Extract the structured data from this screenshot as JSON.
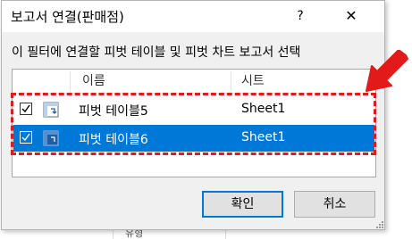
{
  "dialog": {
    "title": "보고서 연결(판매점)",
    "help_label": "?",
    "close_label": "✕",
    "instruction": "이 필터에 연결할 피벗 테이블 및 피벗 차트 보고서 선택"
  },
  "list": {
    "columns": [
      "이름",
      "시트"
    ],
    "rows": [
      {
        "checked": true,
        "name": "피벗 테이블5",
        "sheet": "Sheet1",
        "selected": false,
        "icon": "pivot-table-icon"
      },
      {
        "checked": true,
        "name": "피벗 테이블6",
        "sheet": "Sheet1",
        "selected": true,
        "icon": "pivot-table-icon"
      }
    ]
  },
  "buttons": {
    "ok_label": "확인",
    "cancel_label": "취소"
  },
  "background": {
    "partial_text": "유형"
  },
  "colors": {
    "selection": "#0078d7",
    "annotation": "#e21a1a",
    "dialog_bg": "#f0f0f0"
  }
}
